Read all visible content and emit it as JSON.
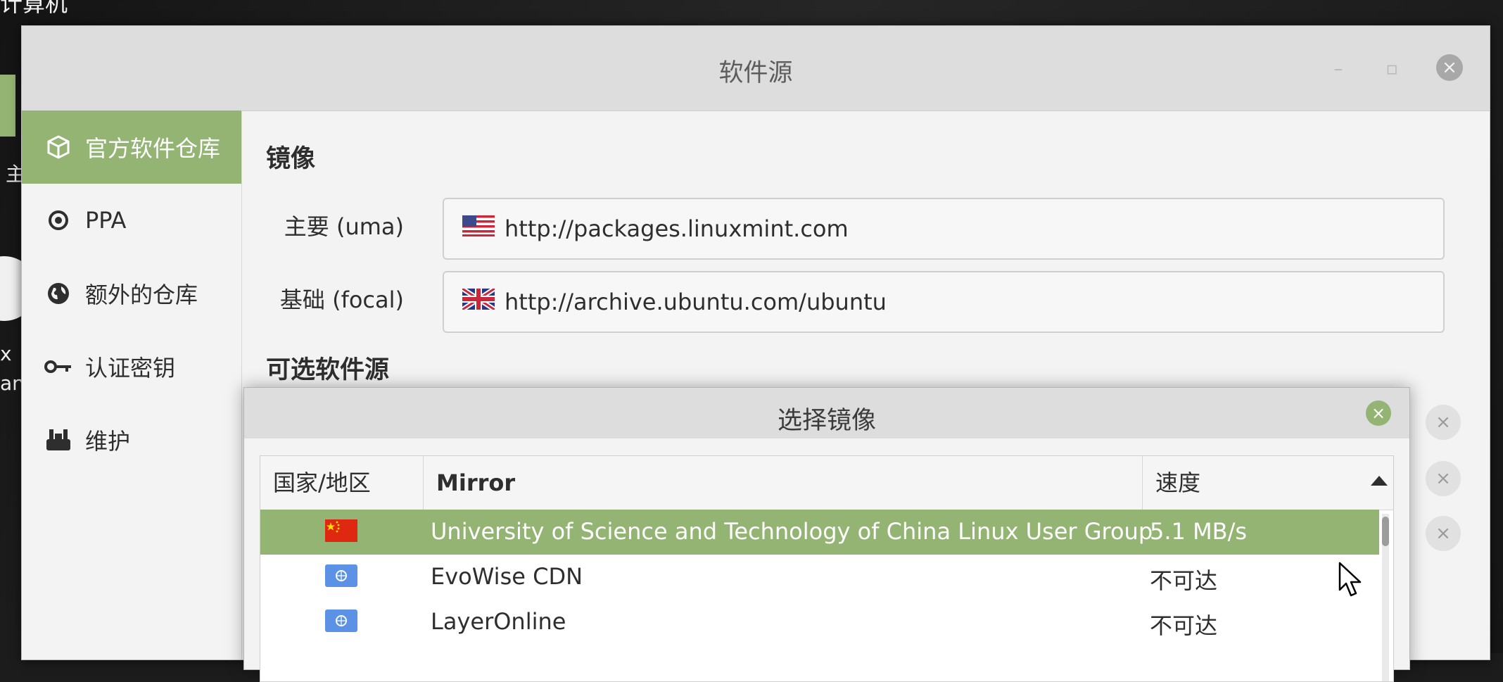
{
  "desktop": {
    "top_text": "计算机",
    "label_1": "主",
    "label_2a": "x",
    "label_2b": "an"
  },
  "window": {
    "title": "软件源",
    "controls": {
      "minimize": "–",
      "maximize": "▫",
      "close": "×"
    }
  },
  "sidebar": {
    "items": [
      {
        "label": "官方软件仓库",
        "icon": "package-icon",
        "active": true
      },
      {
        "label": "PPA",
        "icon": "ppa-icon",
        "active": false
      },
      {
        "label": "额外的仓库",
        "icon": "globe-icon",
        "active": false
      },
      {
        "label": "认证密钥",
        "icon": "key-icon",
        "active": false
      },
      {
        "label": "维护",
        "icon": "maintenance-icon",
        "active": false
      }
    ]
  },
  "mirrors": {
    "section_title": "镜像",
    "main_label": "主要 (uma)",
    "main_url": "http://packages.linuxmint.com",
    "main_flag": "us-flag-icon",
    "base_label": "基础 (focal)",
    "base_url": "http://archive.ubuntu.com/ubuntu",
    "base_flag": "uk-flag-icon"
  },
  "optional": {
    "section_title": "可选软件源"
  },
  "dialog": {
    "title": "选择镜像",
    "close": "×",
    "columns": [
      "国家/地区",
      "Mirror",
      "速度"
    ],
    "rows": [
      {
        "flag": "china-flag-icon",
        "mirror": "University of Science and Technology of China Linux User Group",
        "speed": "5.1 MB/s",
        "selected": true
      },
      {
        "flag": "un-flag-icon",
        "mirror": "EvoWise CDN",
        "speed": "不可达",
        "selected": false
      },
      {
        "flag": "un-flag-icon",
        "mirror": "LayerOnline",
        "speed": "不可达",
        "selected": false
      }
    ]
  },
  "colors": {
    "accent": "#93b473",
    "titlebar": "#dddddd",
    "window_bg": "#f3f3f3"
  }
}
